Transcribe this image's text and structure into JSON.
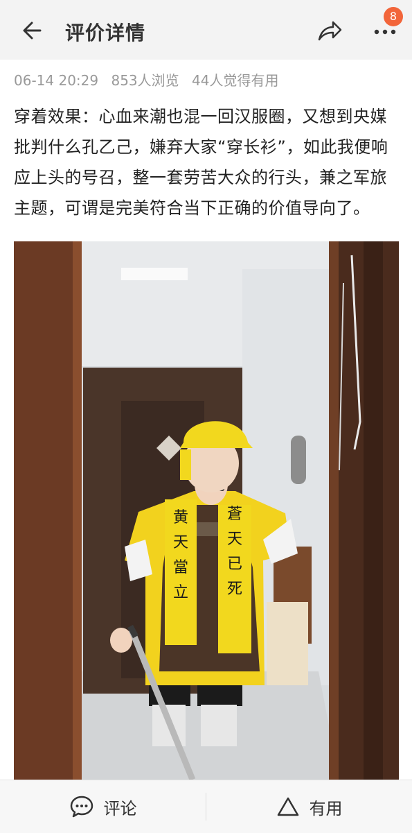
{
  "header": {
    "title": "评价详情",
    "badge_count": "8"
  },
  "meta": {
    "date": "06-14 20:29",
    "views": "853人浏览",
    "useful": "44人觉得有用"
  },
  "review": {
    "text": "穿着效果：心血来潮也混一回汉服圈，又想到央媒批判什么孔乙己，嫌弃大家“穿长衫”，如此我便响应上头的号召，整一套劳苦大众的行头，兼之军旅主题，可谓是完美符合当下正确的价值导向了。"
  },
  "photo": {
    "banner_left": "黄天當立",
    "banner_right": "蒼天已死"
  },
  "footer": {
    "comment_label": "评论",
    "useful_label": "有用"
  },
  "colors": {
    "accent": "#f2653a",
    "scarf_yellow": "#f2d81e"
  }
}
